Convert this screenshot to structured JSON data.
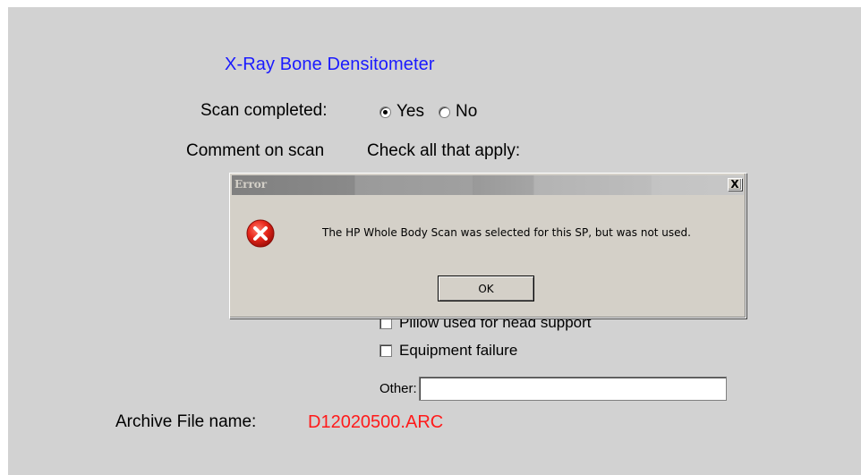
{
  "form": {
    "title": "X-Ray Bone Densitometer",
    "scan_completed_label": "Scan completed:",
    "scan_completed_options": [
      "Yes",
      "No"
    ],
    "scan_completed_selected": "Yes",
    "comment_label": "Comment on scan",
    "check_all_label": "Check all that apply:",
    "checkboxes": [
      {
        "label": "Pillow used for head support",
        "checked": false
      },
      {
        "label": "Equipment failure",
        "checked": false
      }
    ],
    "other_label": "Other:",
    "other_value": "",
    "archive_label": "Archive File name:",
    "archive_value": "D12020500.ARC"
  },
  "dialog": {
    "title": "Error",
    "close_label": "X",
    "icon": "error-icon",
    "message": "The HP Whole Body Scan was selected for this SP, but was not used.",
    "ok_label": "OK"
  },
  "colors": {
    "title": "#1a1aff",
    "archive_value": "#ff1a1a",
    "panel_background": "#d2d2d2",
    "dialog_background": "#d4d0c8"
  }
}
